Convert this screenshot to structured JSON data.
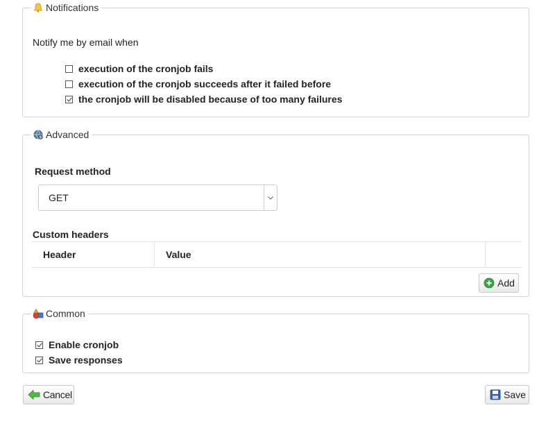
{
  "notifications": {
    "legend": "Notifications",
    "intro": "Notify me by email when",
    "options": [
      {
        "label": "execution of the cronjob fails",
        "checked": false
      },
      {
        "label": "execution of the cronjob succeeds after it failed before",
        "checked": false
      },
      {
        "label": "the cronjob will be disabled because of too many failures",
        "checked": true
      }
    ]
  },
  "advanced": {
    "legend": "Advanced",
    "request_method_label": "Request method",
    "request_method_value": "GET",
    "custom_headers_label": "Custom headers",
    "columns": [
      "Header",
      "Value"
    ],
    "add_label": "Add"
  },
  "common": {
    "legend": "Common",
    "options": [
      {
        "label": "Enable cronjob",
        "checked": true
      },
      {
        "label": "Save responses",
        "checked": true
      }
    ]
  },
  "actions": {
    "cancel_label": "Cancel",
    "save_label": "Save"
  },
  "icons": {
    "notifications": "bell-icon",
    "advanced": "gear-globe-icon",
    "common": "shapes-icon",
    "add": "plus-circle-icon",
    "cancel": "arrow-left-icon",
    "save": "floppy-disk-icon",
    "dropdown": "chevron-down-icon"
  },
  "colors": {
    "add_icon": "#3aa545",
    "cancel_icon": "#56b947",
    "save_icon": "#3a66a8"
  }
}
